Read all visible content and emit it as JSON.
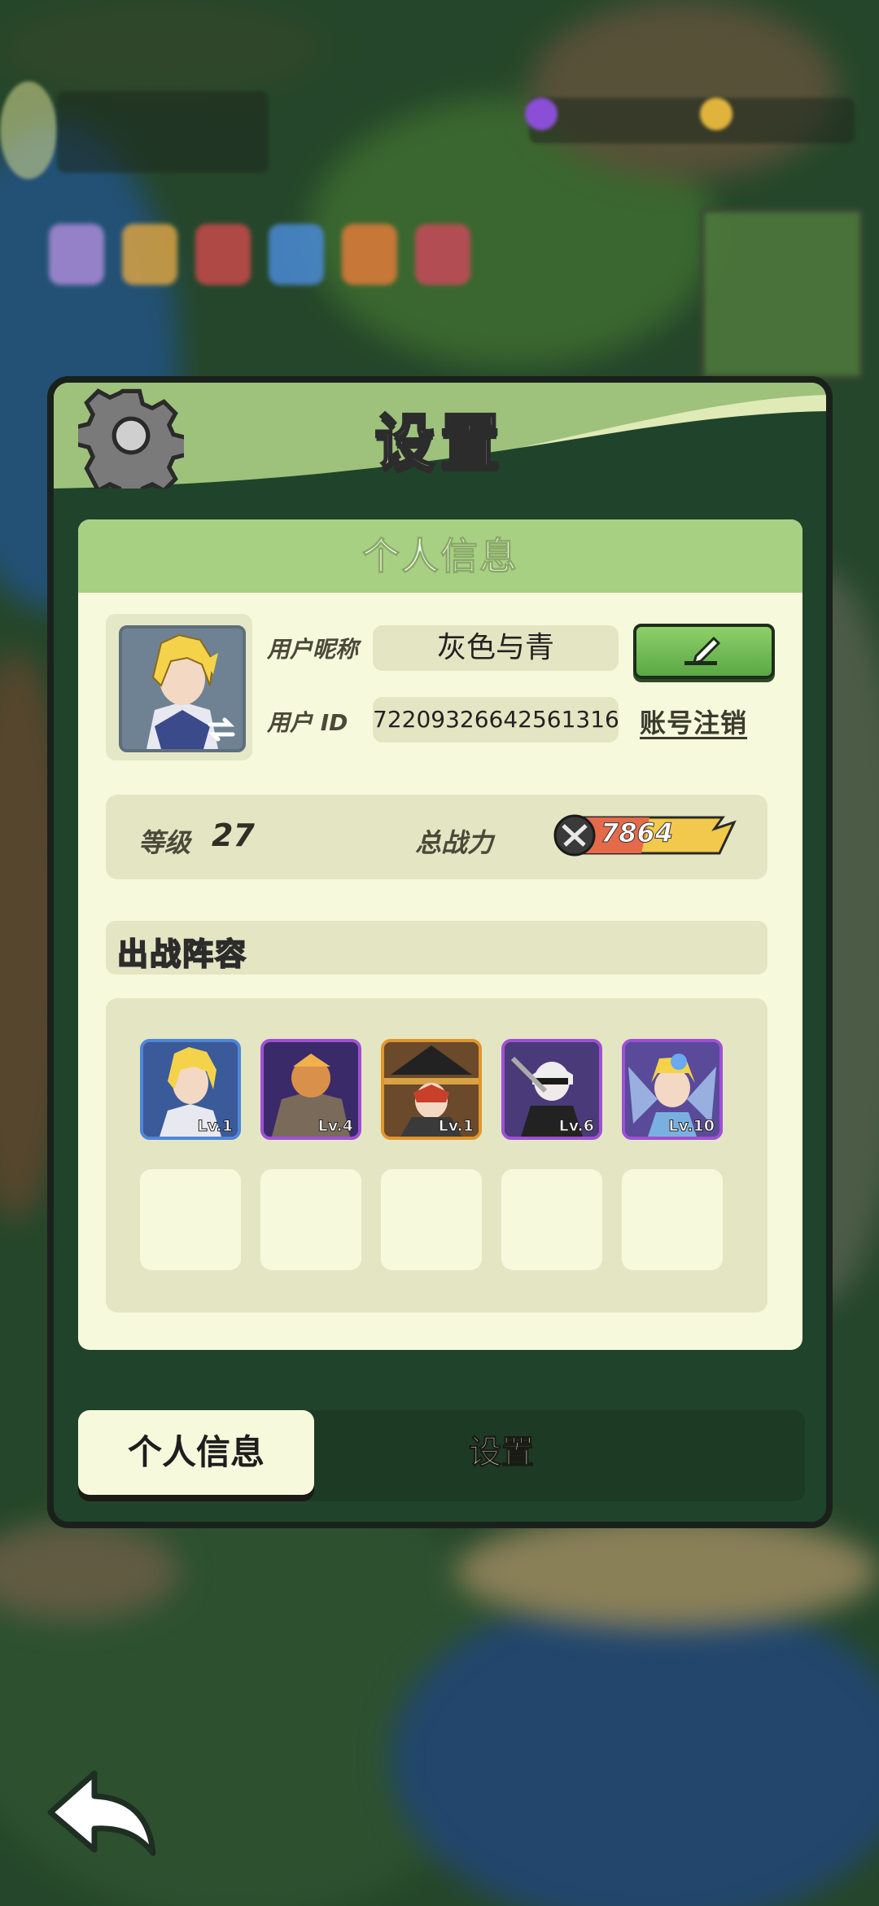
{
  "dialog": {
    "title": "设置",
    "gear_icon": "gear-icon"
  },
  "personal_info": {
    "header": "个人信息",
    "nickname_label": "用户昵称",
    "nickname_value": "灰色与青",
    "id_label": "用户 ID",
    "id_value": "72209326642561316",
    "edit_icon": "pencil-icon",
    "account_cancel": "账号注销"
  },
  "stats": {
    "level_label": "等级",
    "level_value": "27",
    "power_label": "总战力",
    "power_value": "7864"
  },
  "lineup": {
    "title": "出战阵容",
    "heroes": [
      {
        "level": "Lv.1",
        "frame_color": "#4f86d9"
      },
      {
        "level": "Lv.4",
        "frame_color": "#9f4fd6"
      },
      {
        "level": "Lv.1",
        "frame_color": "#e0962c"
      },
      {
        "level": "Lv.6",
        "frame_color": "#9f4fd6"
      },
      {
        "level": "Lv.10",
        "frame_color": "#9f4fd6"
      }
    ],
    "empty_slots": 5
  },
  "tabs": {
    "personal": "个人信息",
    "settings": "设置"
  },
  "colors": {
    "panel_bg": "#f7f9dd",
    "header_green": "#a8d083",
    "dialog_dark": "#20432b"
  }
}
